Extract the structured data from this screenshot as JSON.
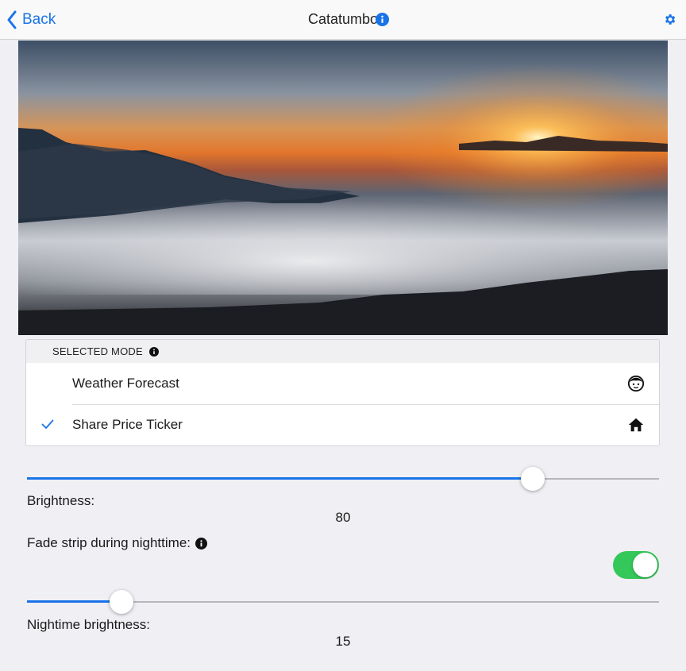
{
  "nav": {
    "back_label": "Back",
    "title": "Catatumbo",
    "info_icon": "info-icon",
    "settings_icon": "gear-icon",
    "accent_color": "#1a73e8"
  },
  "hero": {
    "description_icon": "photo"
  },
  "mode_list": {
    "header": "SELECTED MODE",
    "items": [
      {
        "label": "Weather Forecast",
        "icon": "face-icon",
        "selected": false
      },
      {
        "label": "Share Price Ticker",
        "icon": "home-icon",
        "selected": true
      }
    ]
  },
  "brightness": {
    "label": "Brightness:",
    "value": "80",
    "level": 0.8
  },
  "fade": {
    "label": "Fade strip during nighttime:",
    "enabled": true,
    "toggle_color": "#34c759"
  },
  "night_brightness": {
    "label": "Nightime brightness:",
    "value": "15",
    "level": 0.15
  }
}
